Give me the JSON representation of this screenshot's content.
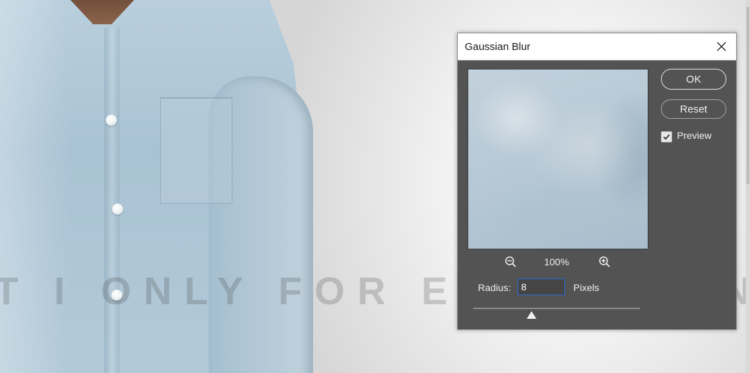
{
  "canvas": {
    "watermark_text": "T I ONLY FOR EDUCATION"
  },
  "dialog": {
    "title": "Gaussian Blur",
    "close_icon": "close-icon",
    "ok_label": "OK",
    "reset_label": "Reset",
    "preview_label": "Preview",
    "preview_checked": true,
    "zoom_level": "100%",
    "zoom_out_icon": "zoom-out-icon",
    "zoom_in_icon": "zoom-in-icon",
    "radius_label": "Radius:",
    "radius_value": "8",
    "unit_label": "Pixels",
    "slider_fraction": 0.35
  },
  "colors": {
    "dialog_bg": "#535353",
    "input_focus_border": "#2a6ad3"
  }
}
